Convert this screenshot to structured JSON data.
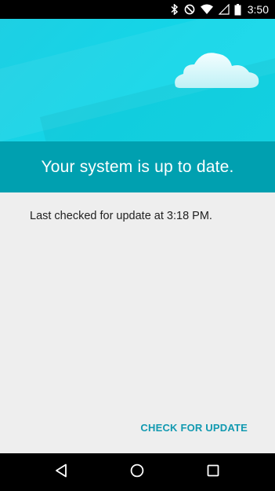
{
  "status_bar": {
    "time": "3:50",
    "icons": [
      "bluetooth-icon",
      "do-not-disturb-icon",
      "wifi-icon",
      "cell-signal-icon",
      "battery-icon"
    ]
  },
  "header": {
    "title": "Your system is up to date."
  },
  "main": {
    "last_checked": "Last checked for update at 3:18 PM.",
    "check_button_label": "CHECK FOR UPDATE"
  },
  "colors": {
    "hero": "#1ecfe3",
    "title_band": "#00a0b0",
    "accent": "#1199b0",
    "background": "#eeeeee"
  },
  "nav_bar": {
    "icons": [
      "back-icon",
      "home-icon",
      "recents-icon"
    ]
  }
}
